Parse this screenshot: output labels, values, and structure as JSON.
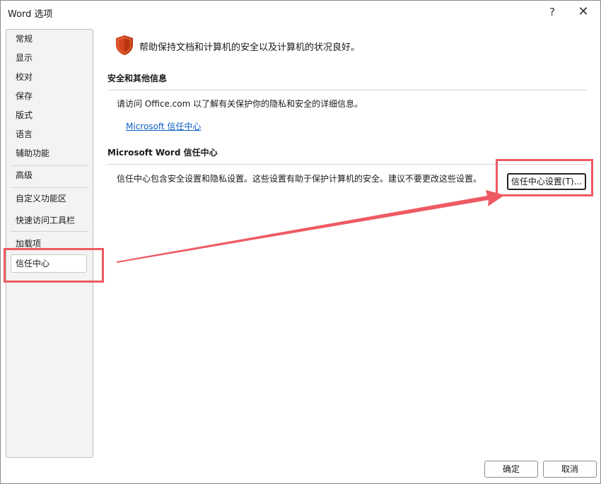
{
  "window": {
    "title": "Word 选项",
    "help": "?",
    "close": "✕"
  },
  "sidebar": {
    "items": [
      {
        "label": "常规"
      },
      {
        "label": "显示"
      },
      {
        "label": "校对"
      },
      {
        "label": "保存"
      },
      {
        "label": "版式"
      },
      {
        "label": "语言"
      },
      {
        "label": "辅助功能"
      },
      {
        "label": "高级"
      },
      {
        "label": "自定义功能区"
      },
      {
        "label": "快速访问工具栏"
      },
      {
        "label": "加载项"
      },
      {
        "label": "信任中心",
        "selected": true
      }
    ]
  },
  "main": {
    "banner_text": "帮助保持文档和计算机的安全以及计算机的状况良好。",
    "security_section": {
      "title": "安全和其他信息",
      "description": "请访问 Office.com  以了解有关保护你的隐私和安全的详细信息。",
      "link": "Microsoft 信任中心"
    },
    "trust_section": {
      "title": "Microsoft Word 信任中心",
      "description": "信任中心包含安全设置和隐私设置。这些设置有助于保护计算机的安全。建议不要更改这些设置。",
      "button_label": "信任中心设置(T)..."
    }
  },
  "footer": {
    "ok_label": "确定",
    "cancel_label": "取消"
  },
  "colors": {
    "accent_link": "#0b5fc4",
    "annotation": "#ee5a62",
    "shield": "#d2451e"
  }
}
